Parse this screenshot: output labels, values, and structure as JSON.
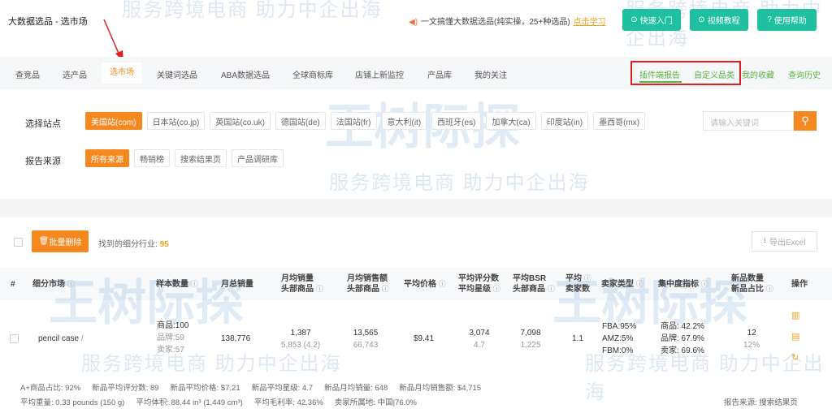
{
  "header": {
    "title": "大数据选品 - 选市场",
    "notice": "一文搞懂大数据选品(纯实操，25+种选品)",
    "learn": "点击学习",
    "buttons": [
      {
        "icon": "play-circle-icon",
        "label": "快速入门"
      },
      {
        "icon": "video-icon",
        "label": "视频教程"
      },
      {
        "icon": "help-icon",
        "label": "使用帮助"
      }
    ]
  },
  "nav": {
    "tabs": [
      "查竞品",
      "选产品",
      "选市场",
      "关键词选品",
      "ABA数据选品",
      "全球商标库",
      "店铺上新监控",
      "产品库",
      "我的关注"
    ],
    "active": "选市场",
    "right_tabs": [
      "插件端报告",
      "自定义品类",
      "我的收藏",
      "查询历史"
    ]
  },
  "filter": {
    "site_label": "选择站点",
    "sites": [
      "美国站(com)",
      "日本站(co.jp)",
      "英国站(co.uk)",
      "德国站(de)",
      "法国站(fr)",
      "意大利(it)",
      "西班牙(es)",
      "加拿大(ca)",
      "印度站(in)",
      "墨西哥(mx)"
    ],
    "source_label": "报告来源",
    "sources": [
      "所有来源",
      "畅销榜",
      "搜索结果页",
      "产品调研库"
    ],
    "search_placeholder": "请输入关键词"
  },
  "toolbar": {
    "delete": "批量删除",
    "found_label": "找到的细分行业:",
    "found_count": "95",
    "export": "导出Excel"
  },
  "table": {
    "headers": {
      "num": "#",
      "market": "细分市场",
      "sample": "样本数量",
      "total": "月总销量",
      "avg_sales": [
        "月均销量",
        "头部商品"
      ],
      "avg_revenue": [
        "月均销售额",
        "头部商品"
      ],
      "price": "平均价格",
      "reviews": [
        "平均评分数",
        "平均星级"
      ],
      "bsr": [
        "平均BSR",
        "头部商品"
      ],
      "sellers": [
        "平均",
        "卖家数"
      ],
      "seller_type": "卖家类型",
      "concentration": "集中度指标",
      "new": [
        "新品数量",
        "新品占比"
      ],
      "ops": "操作"
    },
    "row": {
      "market": "pencil case",
      "sample": [
        "商品:100",
        "品牌:59",
        "卖家:57"
      ],
      "total": "138,776",
      "avg_sales": "1,387",
      "avg_sales_top": "5,853 (4.2)",
      "avg_revenue": "13,565",
      "avg_revenue_top": "66,743",
      "price": "$9.41",
      "reviews": "3,074",
      "stars": "4.7",
      "bsr": "7,098",
      "bsr_top": "1,225",
      "sellers": "1.1",
      "seller_type": [
        "FBA:95%",
        "AMZ:5%",
        "FBM:0%"
      ],
      "concentration": [
        "商品: 42.2%",
        "品牌: 67.9%",
        "卖家: 69.6%"
      ],
      "new_count": "12",
      "new_ratio": "12%"
    }
  },
  "stats": {
    "line1": [
      "A+商品占比: 92%",
      "新品平均评分数: 89",
      "新品平均价格: $7.21",
      "新品平均星级: 4.7",
      "新品月均销量: 648",
      "新品月均销售额: $4,715"
    ],
    "line2": [
      "平均重量: 0.33 pounds (150 g)",
      "平均体积: 88.44 in³ (1,449 cm³)",
      "平均毛利率: 42.36%",
      "卖家所属地: 中国|76.0%"
    ],
    "source": "报告来源: 搜索结果页"
  },
  "watermark": {
    "brand": "王树际探",
    "slogan": "服务跨境电商 助力中企出海"
  }
}
